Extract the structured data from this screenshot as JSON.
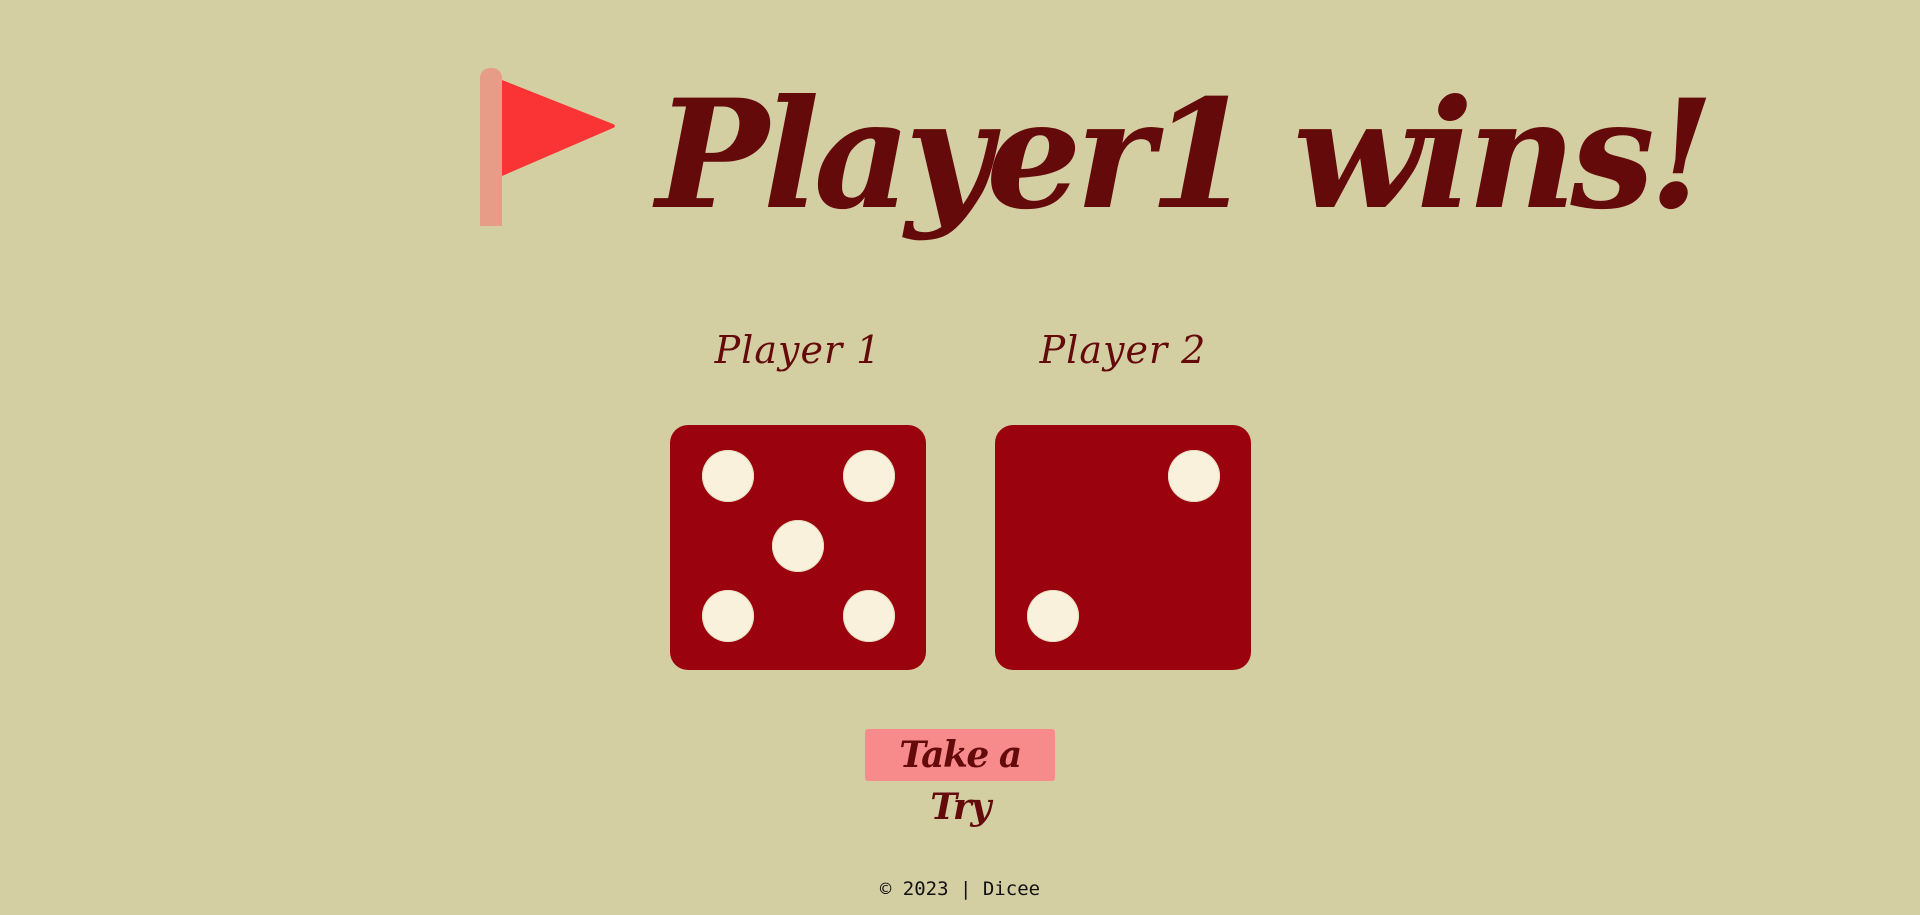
{
  "header": {
    "title": "Player1 wins!",
    "flag_icon": "red-flag-icon"
  },
  "players": [
    {
      "name": "Player 1",
      "die_value": 5
    },
    {
      "name": "Player 2",
      "die_value": 2
    }
  ],
  "action": {
    "button_label": "Take a Try"
  },
  "footer": {
    "text": "© 2023 | Dicee"
  },
  "colors": {
    "background": "#d4cea3",
    "title": "#650a0a",
    "die": "#9a030e",
    "pip": "#faf1dc",
    "button": "#f78b8b",
    "flag": "#fa3434",
    "flag_pole": "#e69c86"
  }
}
